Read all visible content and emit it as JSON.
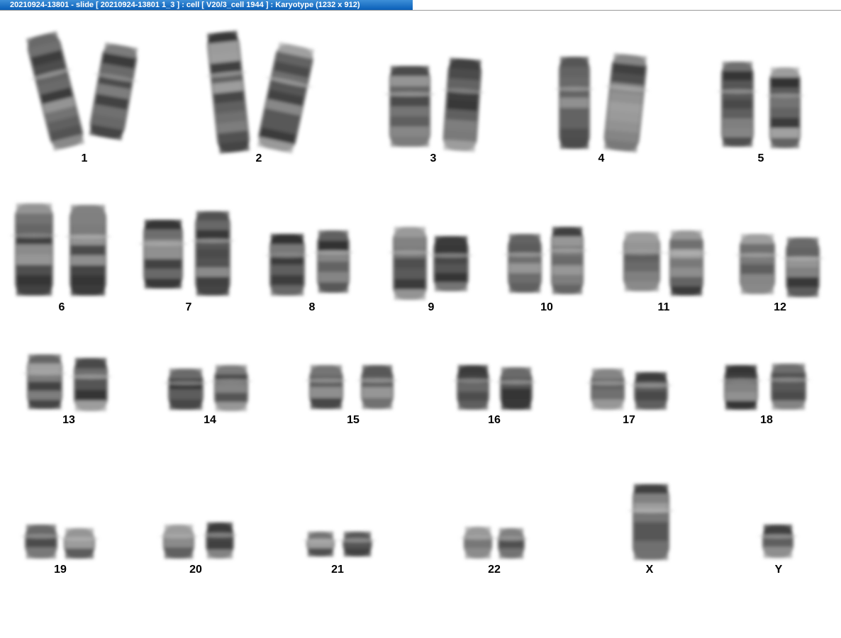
{
  "window": {
    "title": "20210924-13801 - slide [ 20210924-13801 1_3 ] : cell [ V20/3_cell 1944 ] : Karyotype  (1232 x 912)"
  },
  "karyotype": {
    "labels": [
      "1",
      "2",
      "3",
      "4",
      "5",
      "6",
      "7",
      "8",
      "9",
      "10",
      "11",
      "12",
      "13",
      "14",
      "15",
      "16",
      "17",
      "18",
      "19",
      "20",
      "21",
      "22",
      "X",
      "Y"
    ]
  }
}
